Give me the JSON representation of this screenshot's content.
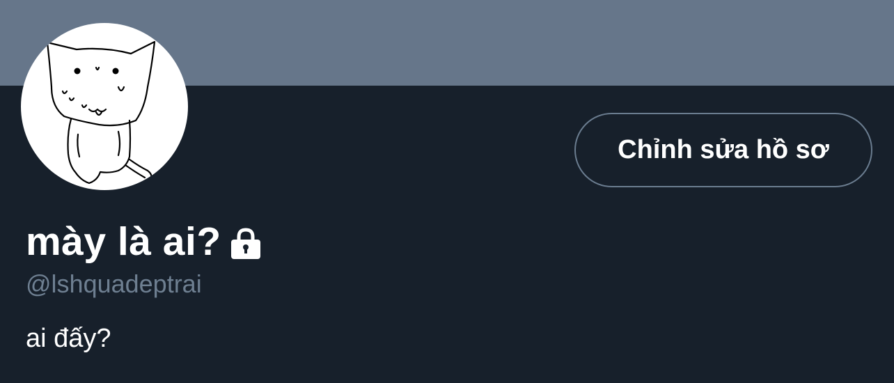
{
  "profile": {
    "edit_button_label": "Chỉnh sửa hồ sơ",
    "display_name": "mày là ai?",
    "handle": "@lshquadeptrai",
    "bio": "ai đấy?",
    "protected_icon": "lock-icon",
    "avatar_icon": "cat-drawing"
  },
  "colors": {
    "banner": "#66768a",
    "background": "#17202b",
    "text_primary": "#ffffff",
    "text_secondary": "#6e7f91",
    "button_border": "#6b7d90"
  }
}
